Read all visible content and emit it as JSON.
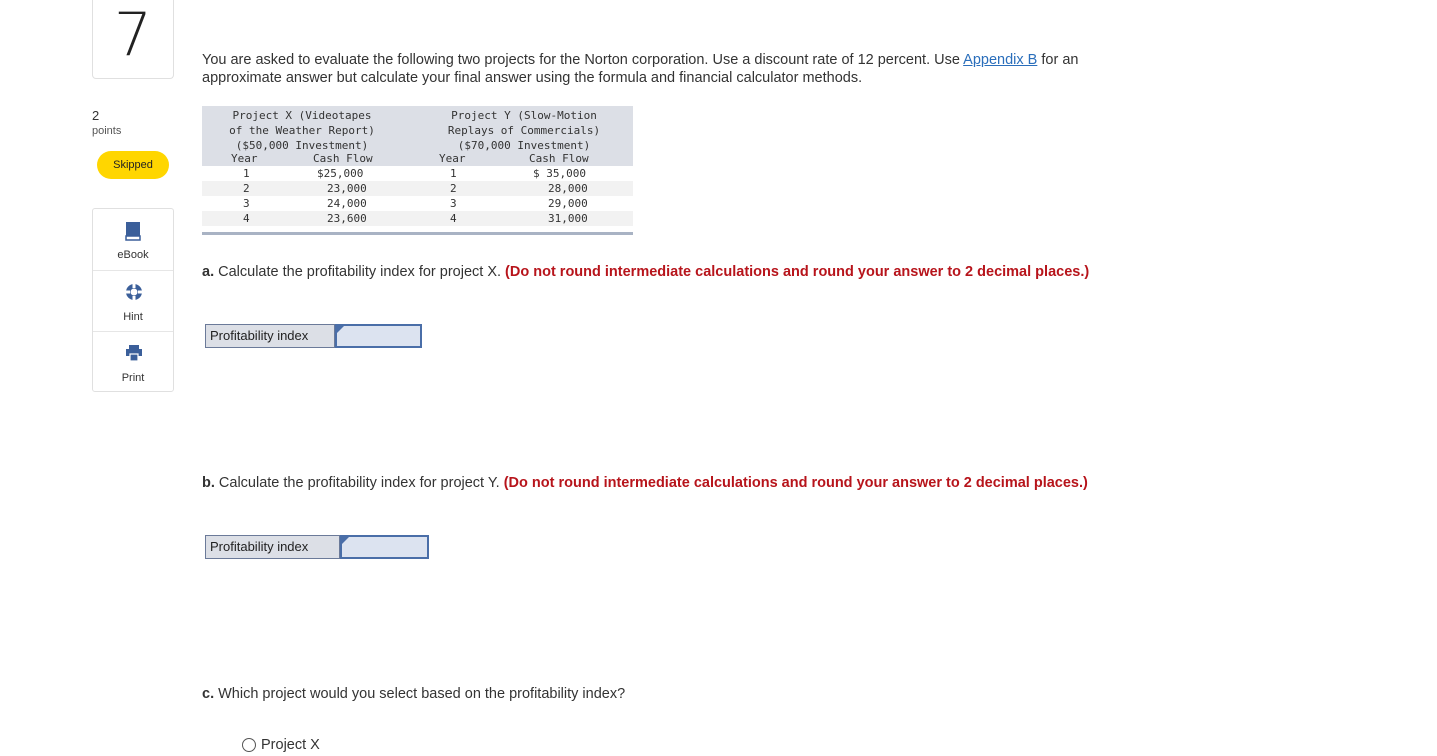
{
  "question": {
    "number": "7",
    "points": "2",
    "points_label": "points",
    "status": "Skipped"
  },
  "tools": [
    {
      "label": "eBook",
      "icon": "book-icon"
    },
    {
      "label": "Hint",
      "icon": "lifebuoy-icon"
    },
    {
      "label": "Print",
      "icon": "printer-icon"
    }
  ],
  "intro": {
    "text_before": "You are asked to evaluate the following two projects for the Norton corporation. Use a discount rate of 12 percent. Use ",
    "link": "Appendix B",
    "text_after": " for an approximate answer but calculate your final answer using the formula and financial calculator methods."
  },
  "table": {
    "project_x": {
      "title_1": "Project X (Videotapes",
      "title_2": "of the Weather Report)",
      "title_3": "($50,000 Investment)",
      "col_year": "Year",
      "col_cash": "Cash Flow"
    },
    "project_y": {
      "title_1": "Project Y (Slow-Motion",
      "title_2": "Replays of Commercials)",
      "title_3": "($70,000 Investment)",
      "col_year": "Year",
      "col_cash": "Cash Flow"
    },
    "rows": [
      {
        "x_year": "1",
        "x_cash": "$25,000",
        "y_year": "1",
        "y_cash": "$ 35,000"
      },
      {
        "x_year": "2",
        "x_cash": "23,000",
        "y_year": "2",
        "y_cash": "28,000"
      },
      {
        "x_year": "3",
        "x_cash": "24,000",
        "y_year": "3",
        "y_cash": "29,000"
      },
      {
        "x_year": "4",
        "x_cash": "23,600",
        "y_year": "4",
        "y_cash": "31,000"
      }
    ]
  },
  "part_a": {
    "letter": "a.",
    "text": " Calculate the profitability index for project X. ",
    "instruction": "(Do not round intermediate calculations and round your answer to 2 decimal places.)",
    "answer_label": "Profitability index",
    "answer_value": ""
  },
  "part_b": {
    "letter": "b.",
    "text": " Calculate the profitability index for project Y. ",
    "instruction": "(Do not round intermediate calculations and round your answer to 2 decimal places.)",
    "answer_label": "Profitability index",
    "answer_value": ""
  },
  "part_c": {
    "letter": "c.",
    "text": " Which project would you select based on the profitability index?",
    "options": [
      "Project X"
    ]
  },
  "colors": {
    "accent_link": "#2a6ebb",
    "instruction_red": "#b7141b",
    "skipped_badge": "#ffd600",
    "tool_icon": "#3b5f9a"
  }
}
